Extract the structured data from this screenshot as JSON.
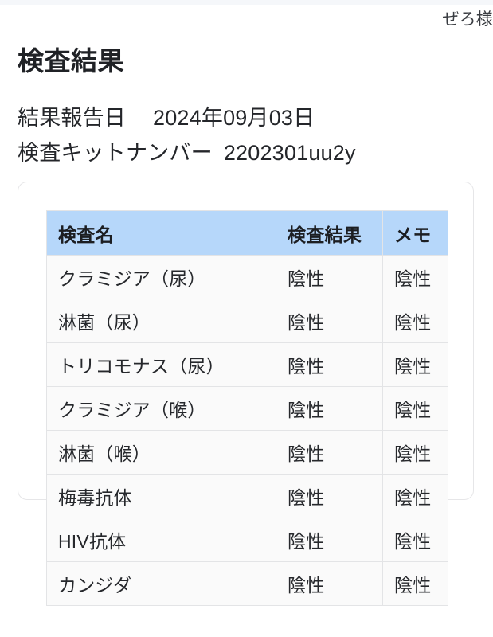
{
  "header": {
    "user_greeting": "ぜろ様"
  },
  "page_title": "検査結果",
  "info": {
    "report_date_label": "結果報告日",
    "report_date_value": "2024年09月03日",
    "kit_number_label": "検査キットナンバー",
    "kit_number_value": "2202301uu2y"
  },
  "table": {
    "columns": [
      "検査名",
      "検査結果",
      "メモ"
    ],
    "rows": [
      {
        "name": "クラミジア（尿）",
        "result": "陰性",
        "memo": "陰性"
      },
      {
        "name": "淋菌（尿）",
        "result": "陰性",
        "memo": "陰性"
      },
      {
        "name": "トリコモナス（尿）",
        "result": "陰性",
        "memo": "陰性"
      },
      {
        "name": "クラミジア（喉）",
        "result": "陰性",
        "memo": "陰性"
      },
      {
        "name": "淋菌（喉）",
        "result": "陰性",
        "memo": "陰性"
      },
      {
        "name": "梅毒抗体",
        "result": "陰性",
        "memo": "陰性"
      },
      {
        "name": "HIV抗体",
        "result": "陰性",
        "memo": "陰性"
      },
      {
        "name": "カンジダ",
        "result": "陰性",
        "memo": "陰性"
      }
    ]
  },
  "colors": {
    "header_row_background": "#b6d7fa",
    "cell_background": "#fafafa",
    "cell_border": "#e3e4e6",
    "card_border": "#e6e6e8",
    "text": "#26282c",
    "top_strip": "#f5f7fa"
  }
}
